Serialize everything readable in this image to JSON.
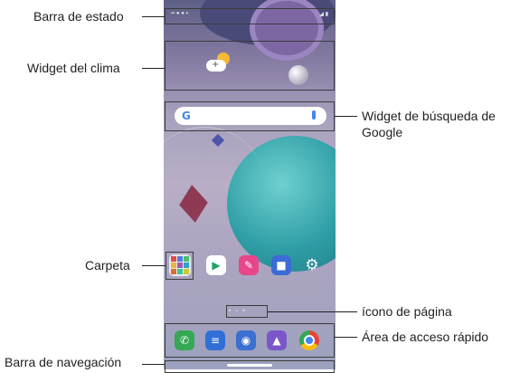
{
  "callouts": {
    "status_bar": "Barra de estado",
    "weather_widget": "Widget del clima",
    "google_widget_line1": "Widget de búsqueda de",
    "google_widget_line2": "Google",
    "folder": "Carpeta",
    "page_icon": "ícono de página",
    "quick_access": "Área de acceso rápido",
    "navigation_bar": "Barra de navegación"
  },
  "apps": [
    {
      "name": "Play Store"
    },
    {
      "name": "Notas"
    },
    {
      "name": "Meet"
    },
    {
      "name": "Ajustes"
    }
  ],
  "dock": [
    {
      "name": "Teléfono"
    },
    {
      "name": "Mensajes"
    },
    {
      "name": "Cámara"
    },
    {
      "name": "Galería"
    },
    {
      "name": "Chrome"
    }
  ],
  "colors": {
    "phone_green": "#34a853",
    "message_blue": "#2f6fd6",
    "camera_blue": "#3b6fd0",
    "gallery_purple": "#7a56c9",
    "meet_blue": "#3a6bd6",
    "notes_pink": "#e8468a"
  }
}
